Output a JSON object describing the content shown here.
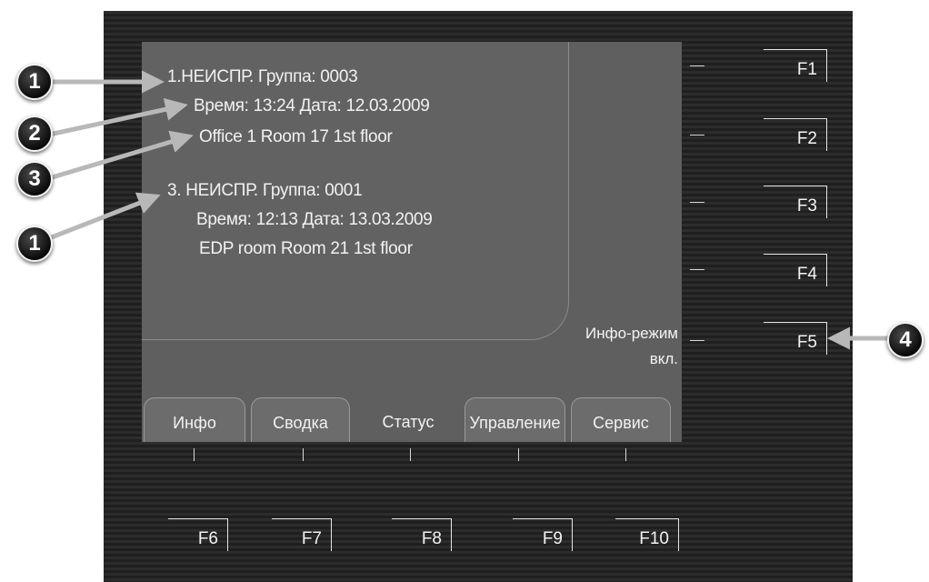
{
  "messages": [
    {
      "line1": "1.НЕИСПР.    Группа: 0003",
      "line2": "Время: 13:24      Дата: 12.03.2009",
      "line3": "Office 1   Room 17   1st floor"
    },
    {
      "line1": "3. НЕИСПР.    Группа: 0001",
      "line2": "Время: 12:13      Дата: 13.03.2009",
      "line3": "EDP room    Room 21    1st floor"
    }
  ],
  "info_mode": {
    "line1": "Инфо-режим",
    "line2": "вкл."
  },
  "tabs": [
    {
      "label": "Инфо"
    },
    {
      "label": "Сводка"
    },
    {
      "label": "Статус"
    },
    {
      "label": "Управление"
    },
    {
      "label": "Сервис"
    }
  ],
  "side_keys": [
    "F1",
    "F2",
    "F3",
    "F4",
    "F5"
  ],
  "bottom_keys": [
    "F6",
    "F7",
    "F8",
    "F9",
    "F10"
  ],
  "callouts": [
    "1",
    "2",
    "3",
    "1",
    "4"
  ],
  "colors": {
    "background": "#232323",
    "screen": "#5f5f5f",
    "text": "#f2f2f2"
  }
}
